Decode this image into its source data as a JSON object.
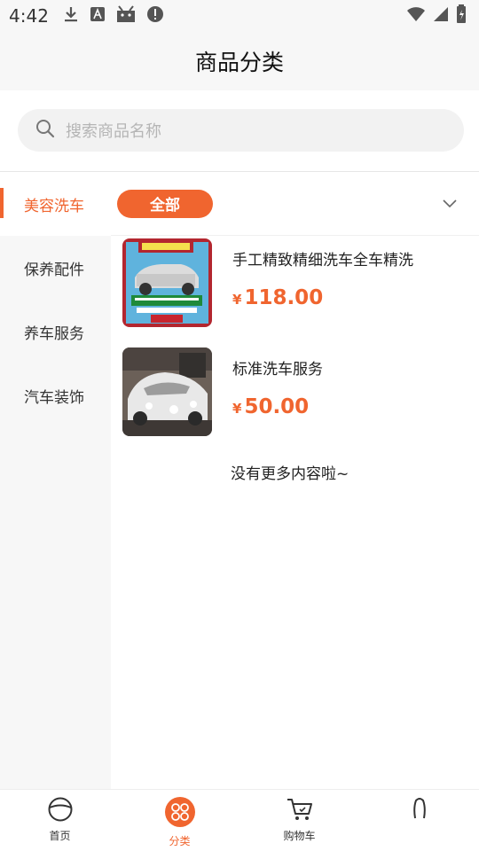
{
  "status_bar": {
    "time": "4:42"
  },
  "header": {
    "title": "商品分类"
  },
  "search": {
    "placeholder": "搜索商品名称"
  },
  "sidebar": {
    "items": [
      {
        "label": "美容洗车",
        "active": true
      },
      {
        "label": "保养配件",
        "active": false
      },
      {
        "label": "养车服务",
        "active": false
      },
      {
        "label": "汽车装饰",
        "active": false
      }
    ]
  },
  "filter": {
    "chip_label": "全部"
  },
  "products": [
    {
      "name": "手工精致精细洗车全车精洗",
      "currency": "¥",
      "price": "118.00"
    },
    {
      "name": "标准洗车服务",
      "currency": "¥",
      "price": "50.00"
    }
  ],
  "list_end_text": "没有更多内容啦~",
  "tabbar": {
    "tabs": [
      {
        "label": "首页",
        "icon": "steering-wheel-icon"
      },
      {
        "label": "分类",
        "icon": "category-icon",
        "active": true
      },
      {
        "label": "购物车",
        "icon": "cart-icon"
      },
      {
        "label": "",
        "icon": "profile-icon"
      }
    ]
  },
  "colors": {
    "accent": "#f0652f",
    "background": "#f7f7f7"
  }
}
